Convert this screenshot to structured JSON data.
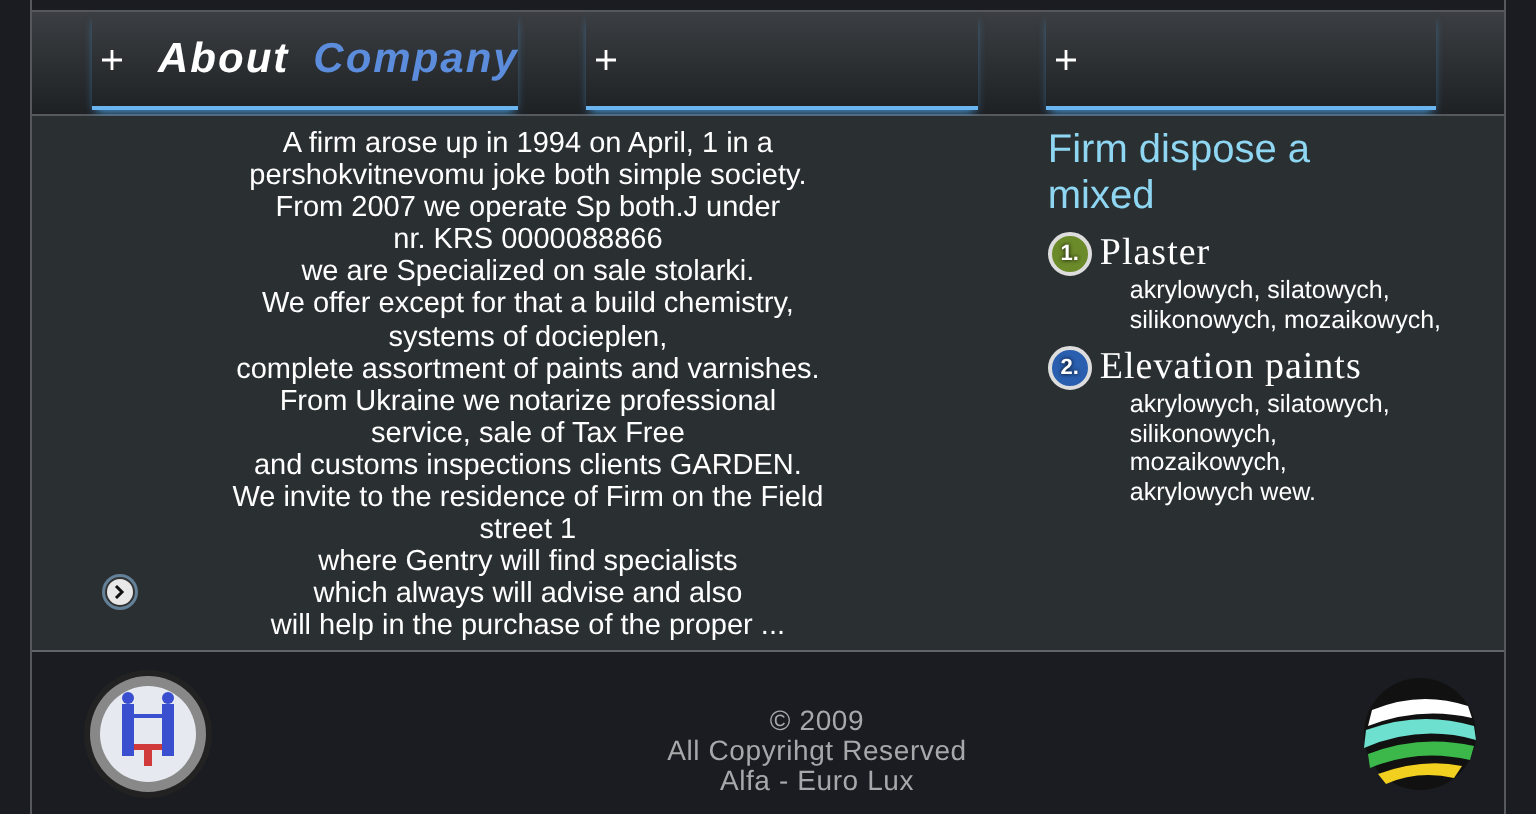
{
  "header": {
    "title": "About",
    "title_accent": "Company"
  },
  "content": {
    "lines": [
      "A firm arose up in 1994 on April, 1 in a",
      "pershokvitnevomu joke both simple society.",
      "From 2007 we operate Sp both.J under",
      "nr. KRS 0000088866",
      "we are Specialized on sale stolarki.",
      "We offer except for that a build chemistry,",
      "systems of docieplen,",
      "complete assortment of paints and varnishes.",
      "From Ukraine we notarize professional",
      "service, sale of Tax Free",
      "and customs inspections clients GARDEN.",
      "We invite to the residence of Firm on the Field",
      "street 1",
      "where Gentry will find specialists",
      "which always will advise and also",
      "will help in the purchase of the proper ..."
    ]
  },
  "sidebar": {
    "heading": "Firm dispose a mixed",
    "items": [
      {
        "number": "1.",
        "title": "Plaster",
        "color": "#6b8a2a",
        "lines": [
          "akrylowych, silatowych,",
          "silikonowych, mozaikowych,"
        ]
      },
      {
        "number": "2.",
        "title": "Elevation paints",
        "color": "#2a5fb0",
        "lines": [
          "akrylowych, silatowych,",
          "silikonowych,",
          "mozaikowych,",
          "akrylowych wew."
        ]
      }
    ]
  },
  "footer": {
    "lines": [
      "© 2009",
      "All Copyrihgt Reserved",
      "Alfa - Euro Lux"
    ]
  }
}
